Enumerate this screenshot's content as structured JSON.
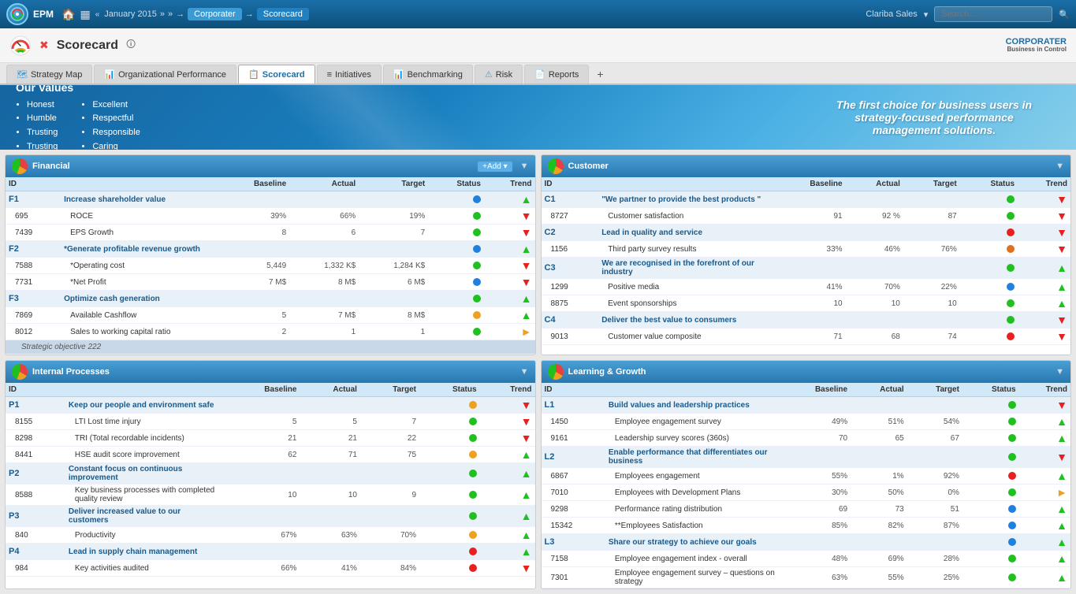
{
  "topNav": {
    "appName": "EPM",
    "homeIcon": "🏠",
    "breadcrumbs": [
      "January 2015",
      "Corporater",
      "Scorecard"
    ],
    "userName": "Clariba Sales",
    "searchPlaceholder": "Search..."
  },
  "secondBar": {
    "pageTitle": "Scorecard",
    "infoIcon": "🛈",
    "corpName": "CORPORATER",
    "corpTagline": "Business in Control"
  },
  "tabs": [
    {
      "label": "Strategy Map",
      "icon": "🗺",
      "active": false
    },
    {
      "label": "Organizational Performance",
      "icon": "📊",
      "active": false
    },
    {
      "label": "Scorecard",
      "icon": "📋",
      "active": true
    },
    {
      "label": "Initiatives",
      "icon": "≡",
      "active": false
    },
    {
      "label": "Benchmarking",
      "icon": "📊",
      "active": false
    },
    {
      "label": "Risk",
      "icon": "⚠",
      "active": false
    },
    {
      "label": "Reports",
      "icon": "📄",
      "active": false
    }
  ],
  "banner": {
    "title": "Our Values",
    "col1": [
      "Honest",
      "Humble",
      "Trusting",
      "Trusting"
    ],
    "col2": [
      "Excellent",
      "Respectful",
      "Responsible",
      "Caring"
    ],
    "tagline": "The first choice for business users in strategy-focused performance management solutions."
  },
  "financial": {
    "title": "Financial",
    "headers": [
      "ID",
      "",
      "Baseline",
      "Actual",
      "Target",
      "Status",
      "Trend"
    ],
    "rows": [
      {
        "type": "objective",
        "id": "F1",
        "label": "Increase shareholder value",
        "status": "blue",
        "trend": "up"
      },
      {
        "type": "kpi",
        "id": "695",
        "label": "ROCE",
        "baseline": "39%",
        "actual": "66%",
        "target": "19%",
        "status": "green",
        "trend": "down"
      },
      {
        "type": "kpi",
        "id": "7439",
        "label": "EPS Growth",
        "baseline": "8",
        "actual": "6",
        "target": "7",
        "status": "green",
        "trend": "down"
      },
      {
        "type": "objective",
        "id": "F2",
        "label": "*Generate profitable revenue growth",
        "status": "blue",
        "trend": "up"
      },
      {
        "type": "kpi",
        "id": "7588",
        "label": "*Operating cost",
        "baseline": "5,449",
        "actual": "1,332 K$",
        "target": "1,284 K$",
        "status": "green",
        "trend": "down"
      },
      {
        "type": "kpi",
        "id": "7731",
        "label": "*Net Profit",
        "baseline": "7 M$",
        "actual": "8 M$",
        "target": "6 M$",
        "status": "blue",
        "trend": "down"
      },
      {
        "type": "objective",
        "id": "F3",
        "label": "Optimize cash generation",
        "status": "green",
        "trend": "up"
      },
      {
        "type": "kpi",
        "id": "7869",
        "label": "Available Cashflow",
        "baseline": "5",
        "actual": "7 M$",
        "target": "8 M$",
        "status": "yellow",
        "trend": "up"
      },
      {
        "type": "kpi",
        "id": "8012",
        "label": "Sales to working capital ratio",
        "baseline": "2",
        "actual": "1",
        "target": "1",
        "status": "green",
        "trend": "right"
      },
      {
        "type": "strategic",
        "id": "",
        "label": "Strategic objective 222",
        "status": "",
        "trend": ""
      }
    ]
  },
  "customer": {
    "title": "Customer",
    "headers": [
      "ID",
      "",
      "Baseline",
      "Actual",
      "Target",
      "Status",
      "Trend"
    ],
    "rows": [
      {
        "type": "objective",
        "id": "C1",
        "label": "\"We partner to provide the best products \"",
        "status": "green",
        "trend": "down"
      },
      {
        "type": "kpi",
        "id": "8727",
        "label": "Customer satisfaction",
        "baseline": "91",
        "actual": "92 %",
        "target": "87",
        "status": "green",
        "trend": "down"
      },
      {
        "type": "objective",
        "id": "C2",
        "label": "Lead in quality and service",
        "status": "red",
        "trend": "down"
      },
      {
        "type": "kpi",
        "id": "1156",
        "label": "Third party survey results",
        "baseline": "33%",
        "actual": "46%",
        "target": "76%",
        "status": "orange",
        "trend": "down"
      },
      {
        "type": "objective",
        "id": "C3",
        "label": "We are recognised in the forefront of our industry",
        "status": "green",
        "trend": "up"
      },
      {
        "type": "kpi",
        "id": "1299",
        "label": "Positive media",
        "baseline": "41%",
        "actual": "70%",
        "target": "22%",
        "status": "blue",
        "trend": "up"
      },
      {
        "type": "kpi",
        "id": "8875",
        "label": "Event sponsorships",
        "baseline": "10",
        "actual": "10",
        "target": "10",
        "status": "green",
        "trend": "up"
      },
      {
        "type": "objective",
        "id": "C4",
        "label": "Deliver the best value to consumers",
        "status": "green",
        "trend": "down"
      },
      {
        "type": "kpi",
        "id": "9013",
        "label": "Customer value composite",
        "baseline": "71",
        "actual": "68",
        "target": "74",
        "status": "red",
        "trend": "down"
      }
    ]
  },
  "internalProcesses": {
    "title": "Internal Processes",
    "headers": [
      "ID",
      "",
      "Baseline",
      "Actual",
      "Target",
      "Status",
      "Trend"
    ],
    "rows": [
      {
        "type": "objective",
        "id": "P1",
        "label": "Keep our people and environment safe",
        "status": "yellow",
        "trend": "down"
      },
      {
        "type": "kpi",
        "id": "8155",
        "label": "LTI Lost time injury",
        "baseline": "5",
        "actual": "5",
        "target": "7",
        "status": "green",
        "trend": "down"
      },
      {
        "type": "kpi",
        "id": "8298",
        "label": "TRI (Total recordable incidents)",
        "baseline": "21",
        "actual": "21",
        "target": "22",
        "status": "green",
        "trend": "down"
      },
      {
        "type": "kpi",
        "id": "8441",
        "label": "HSE audit score improvement",
        "baseline": "62",
        "actual": "71",
        "target": "75",
        "status": "yellow",
        "trend": "up"
      },
      {
        "type": "objective",
        "id": "P2",
        "label": "Constant focus on continuous improvement",
        "status": "green",
        "trend": "up"
      },
      {
        "type": "kpi",
        "id": "8588",
        "label": "Key business processes with completed quality review",
        "baseline": "10",
        "actual": "10",
        "target": "9",
        "status": "green",
        "trend": "up"
      },
      {
        "type": "objective",
        "id": "P3",
        "label": "Deliver increased value to our customers",
        "status": "green",
        "trend": "up"
      },
      {
        "type": "kpi",
        "id": "840",
        "label": "Productivity",
        "baseline": "67%",
        "actual": "63%",
        "target": "70%",
        "status": "yellow",
        "trend": "up"
      },
      {
        "type": "objective",
        "id": "P4",
        "label": "Lead in supply chain management",
        "status": "red",
        "trend": "up"
      },
      {
        "type": "kpi",
        "id": "984",
        "label": "Key activities audited",
        "baseline": "66%",
        "actual": "41%",
        "target": "84%",
        "status": "red",
        "trend": "down"
      }
    ]
  },
  "learningGrowth": {
    "title": "Learning & Growth",
    "headers": [
      "ID",
      "",
      "Baseline",
      "Actual",
      "Target",
      "Status",
      "Trend"
    ],
    "rows": [
      {
        "type": "objective",
        "id": "L1",
        "label": "Build values and leadership practices",
        "status": "green",
        "trend": "down"
      },
      {
        "type": "kpi",
        "id": "1450",
        "label": "Employee engagement survey",
        "baseline": "49%",
        "actual": "51%",
        "target": "54%",
        "status": "green",
        "trend": "up"
      },
      {
        "type": "kpi",
        "id": "9161",
        "label": "Leadership survey scores (360s)",
        "baseline": "70",
        "actual": "65",
        "target": "67",
        "status": "green",
        "trend": "up"
      },
      {
        "type": "objective",
        "id": "L2",
        "label": "Enable performance that differentiates our business",
        "status": "green",
        "trend": "down"
      },
      {
        "type": "kpi",
        "id": "6867",
        "label": "Employees engagement",
        "baseline": "55%",
        "actual": "1%",
        "target": "92%",
        "status": "red",
        "trend": "up"
      },
      {
        "type": "kpi",
        "id": "7010",
        "label": "Employees with Development Plans",
        "baseline": "30%",
        "actual": "50%",
        "target": "0%",
        "status": "green",
        "trend": "right"
      },
      {
        "type": "kpi",
        "id": "9298",
        "label": "Performance rating distribution",
        "baseline": "69",
        "actual": "73",
        "target": "51",
        "status": "blue",
        "trend": "up"
      },
      {
        "type": "kpi",
        "id": "15342",
        "label": "**Employees Satisfaction",
        "baseline": "85%",
        "actual": "82%",
        "target": "87%",
        "status": "blue",
        "trend": "up"
      },
      {
        "type": "objective",
        "id": "L3",
        "label": "Share our strategy to achieve our goals",
        "status": "blue",
        "trend": "up"
      },
      {
        "type": "kpi",
        "id": "7158",
        "label": "Employee engagement index - overall",
        "baseline": "48%",
        "actual": "69%",
        "target": "28%",
        "status": "green",
        "trend": "up"
      },
      {
        "type": "kpi",
        "id": "7301",
        "label": "Employee engagement survey – questions on strategy",
        "baseline": "63%",
        "actual": "55%",
        "target": "25%",
        "status": "green",
        "trend": "up"
      }
    ]
  }
}
